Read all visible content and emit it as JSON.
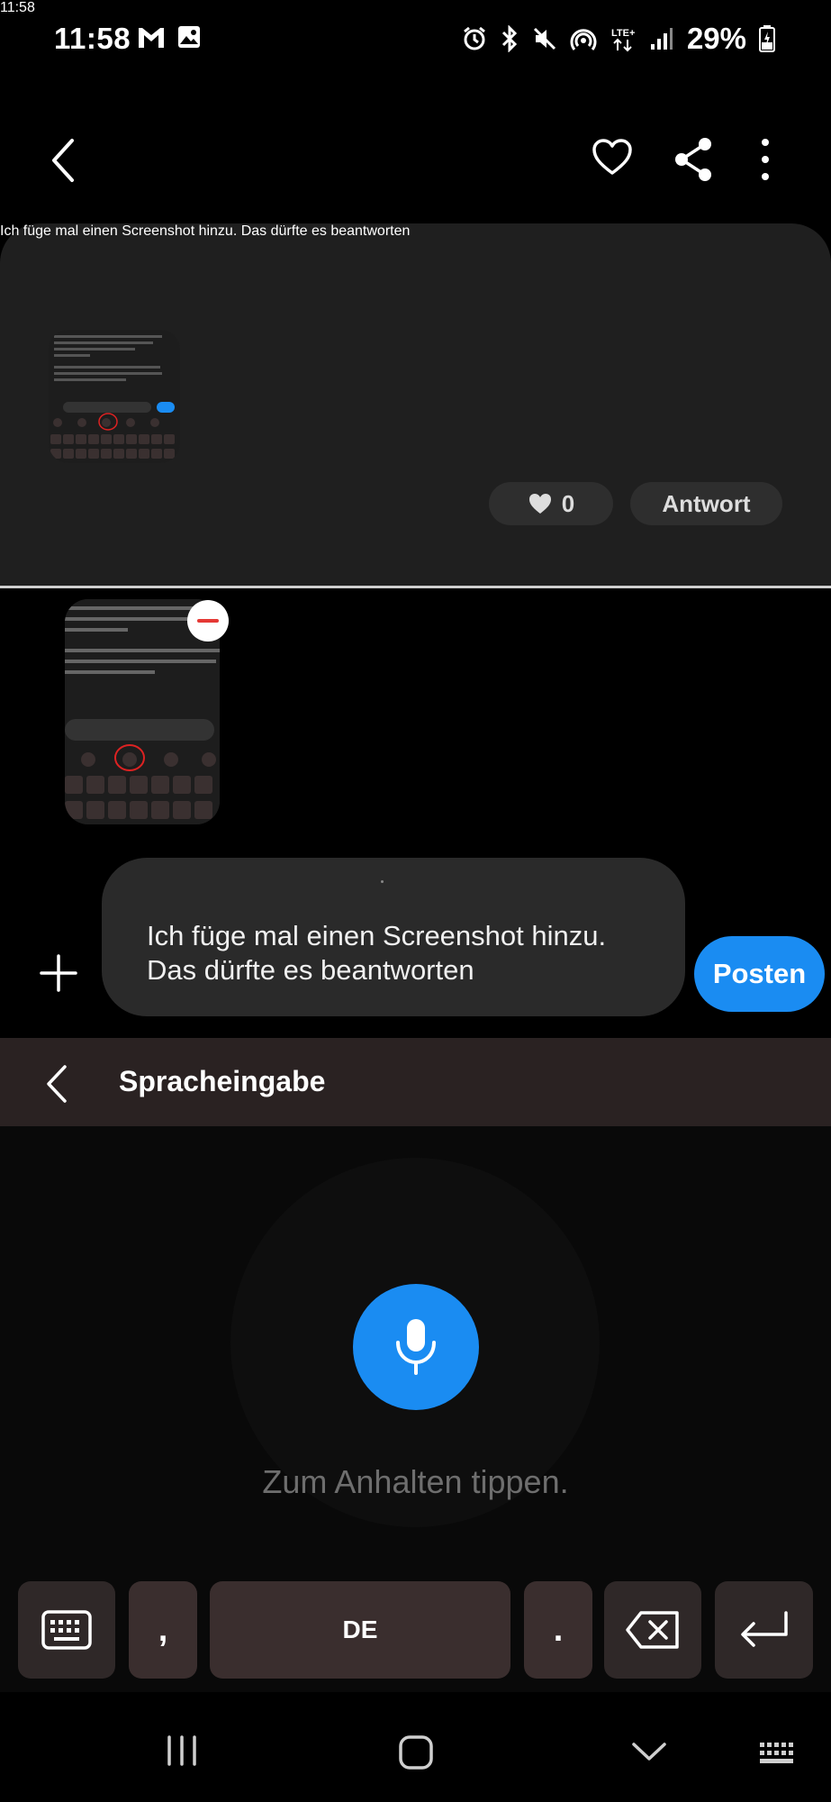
{
  "status_bar": {
    "time": "11:58",
    "network": "LTE+",
    "battery": "29%"
  },
  "comment": {
    "text": "Ich füge mal einen Screenshot hinzu. Das dürfte es beantworten",
    "time": "11:58",
    "likes": "0",
    "reply_label": "Antwort"
  },
  "composer": {
    "input_text": "Ich füge mal einen Screenshot hinzu. Das dürfte es beantworten",
    "post_label": "Posten"
  },
  "voice_input": {
    "title": "Spracheingabe",
    "hint": "Zum Anhalten tippen."
  },
  "keyboard": {
    "comma": ",",
    "space_label": "DE",
    "period": "."
  },
  "colors": {
    "accent": "#1a8cf2",
    "background": "#000000",
    "card": "#1f1f1f",
    "voice_header": "#2a2222",
    "remove": "#e53935"
  }
}
